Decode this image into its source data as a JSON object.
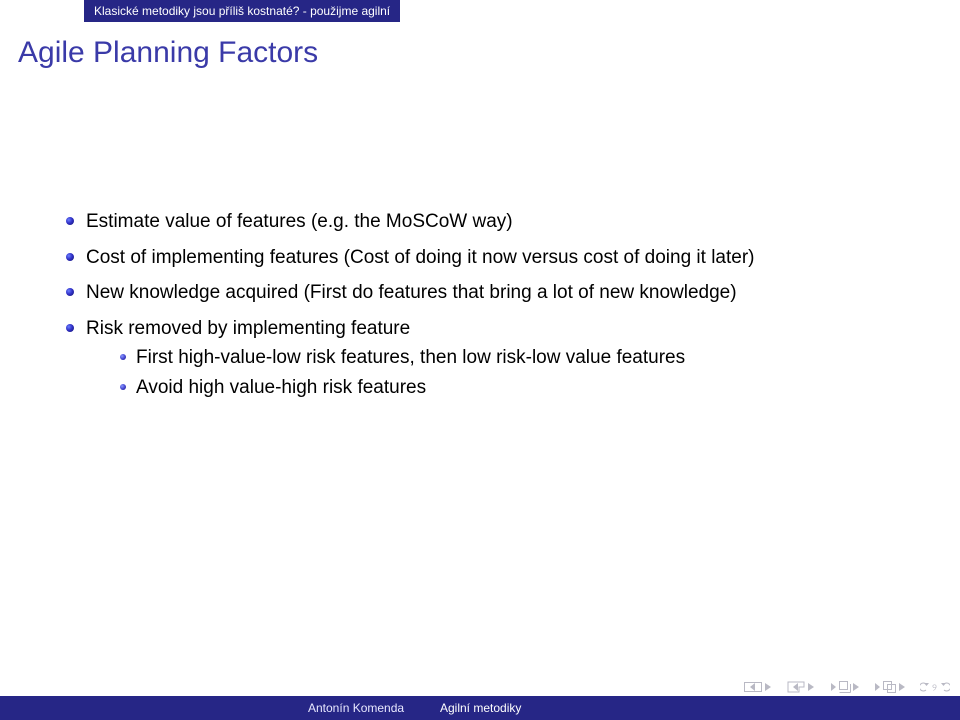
{
  "header_band": "Klasické metodiky jsou příliš kostnaté? - použijme agilní",
  "slide_title": "Agile Planning Factors",
  "bullets": {
    "b1": "Estimate value of features (e.g. the MoSCoW way)",
    "b2": "Cost of implementing features (Cost of doing it now versus cost of doing it later)",
    "b3": "New knowledge acquired (First do features that bring a lot of new knowledge)",
    "b4": "Risk removed by implementing feature",
    "b4_sub1": "First high-value-low risk features, then low risk-low value features",
    "b4_sub2": "Avoid high value-high risk features"
  },
  "footer": {
    "author": "Antonín Komenda",
    "title": "Agilní metodiky"
  }
}
